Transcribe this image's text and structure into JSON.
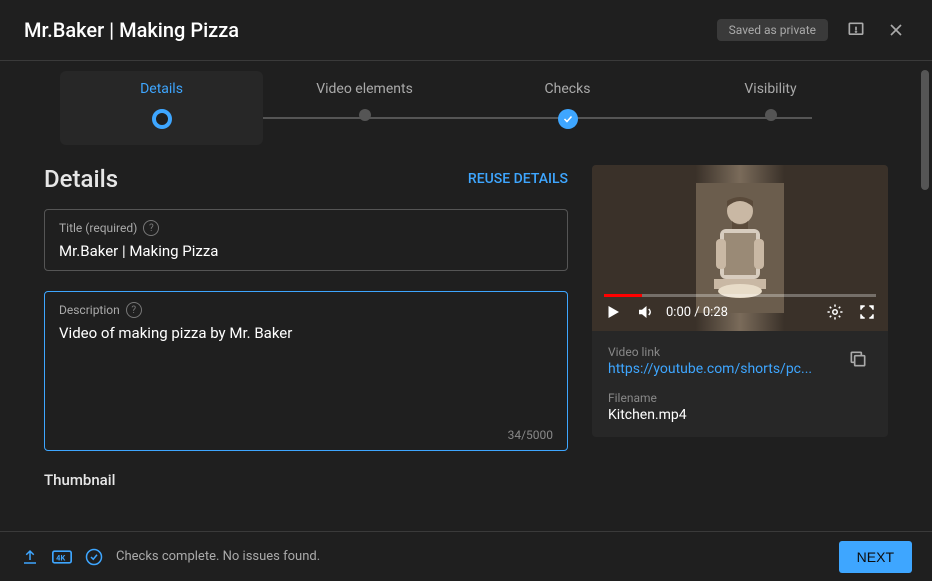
{
  "header": {
    "title": "Mr.Baker | Making Pizza",
    "saved": "Saved as private"
  },
  "steps": {
    "s1": "Details",
    "s2": "Video elements",
    "s3": "Checks",
    "s4": "Visibility"
  },
  "details": {
    "heading": "Details",
    "reuse": "REUSE DETAILS",
    "title_label": "Title (required)",
    "title_value": "Mr.Baker | Making Pizza",
    "desc_label": "Description",
    "desc_value": "Video of making pizza by Mr. Baker",
    "counter": "34/5000",
    "thumb": "Thumbnail"
  },
  "preview": {
    "time": "0:00 / 0:28",
    "link_label": "Video link",
    "link": "https://youtube.com/shorts/pc...",
    "file_label": "Filename",
    "filename": "Kitchen.mp4"
  },
  "footer": {
    "status": "Checks complete. No issues found.",
    "next": "NEXT"
  }
}
